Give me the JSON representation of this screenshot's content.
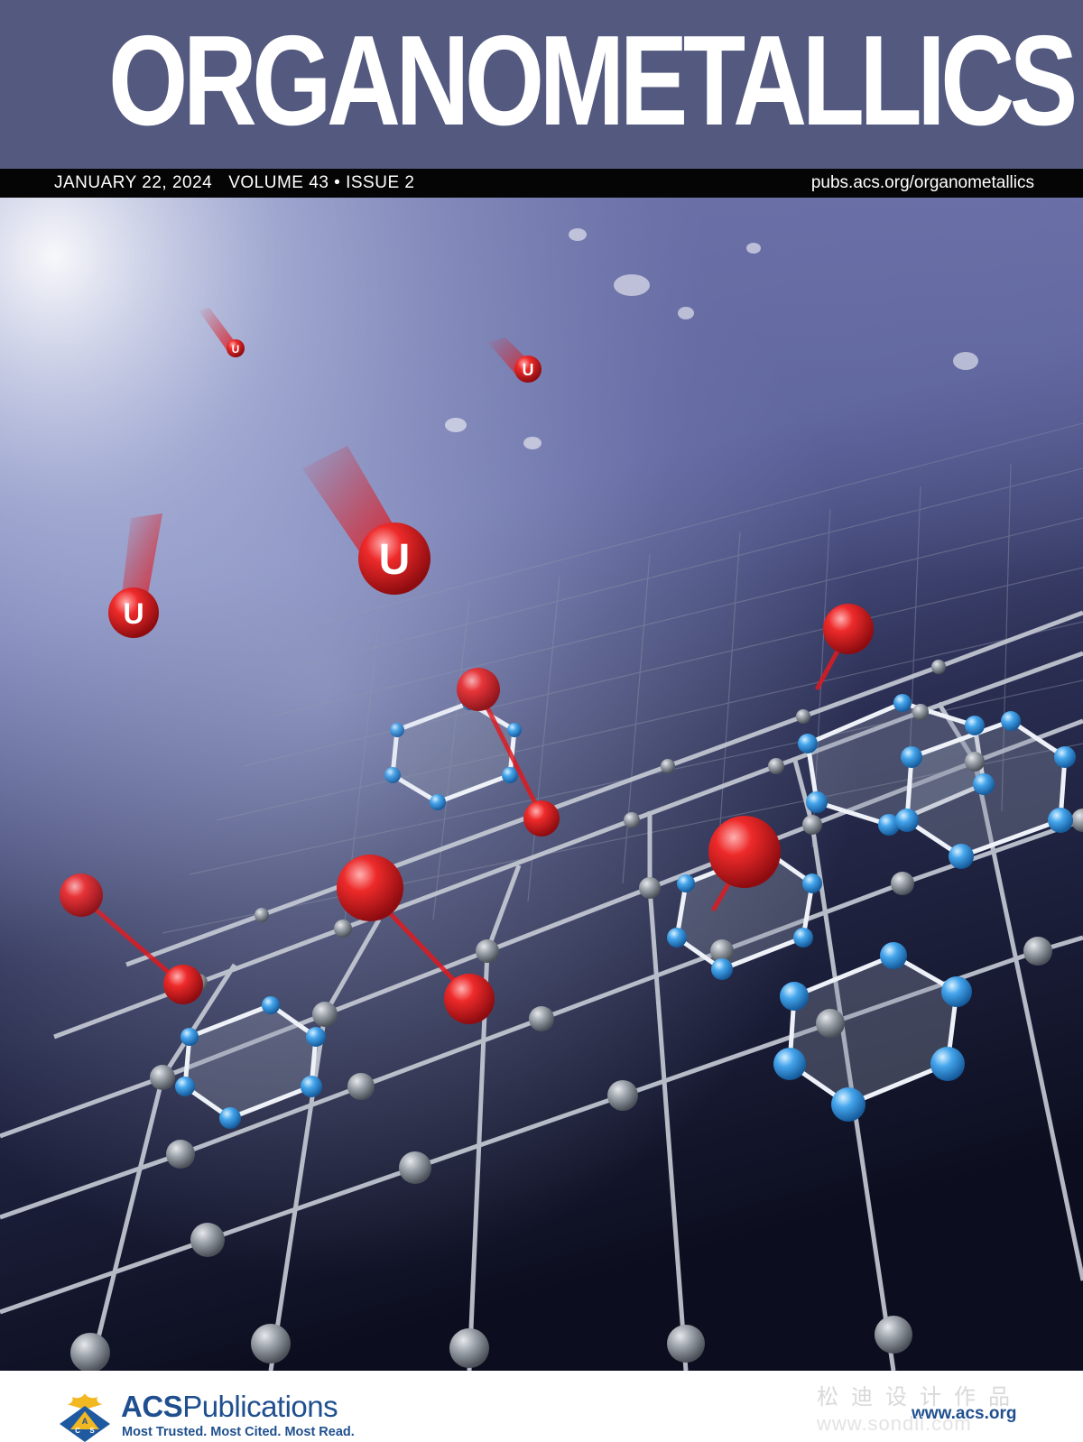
{
  "journal": {
    "title": "ORGANOMETALLICS",
    "date": "JANUARY 22, 2024",
    "volume_issue": "VOLUME 43 • ISSUE 2",
    "url": "pubs.acs.org/organometallics"
  },
  "cover_art": {
    "atom_label": "U",
    "colors": {
      "masthead": "#53597f",
      "bar": "#050505",
      "uranium": "#e01a1f",
      "nitrogen": "#3f9ee8",
      "carbon": "#9aa0a8"
    }
  },
  "footer": {
    "brand_acs": "ACS",
    "brand_rest": "Publications",
    "tagline": "Most Trusted. Most Cited. Most Read.",
    "logo_letters": [
      "A",
      "C",
      "S"
    ],
    "site": "www.acs.org",
    "watermark_cn": "松迪设计作品",
    "watermark_url": "www.sondii.com"
  }
}
